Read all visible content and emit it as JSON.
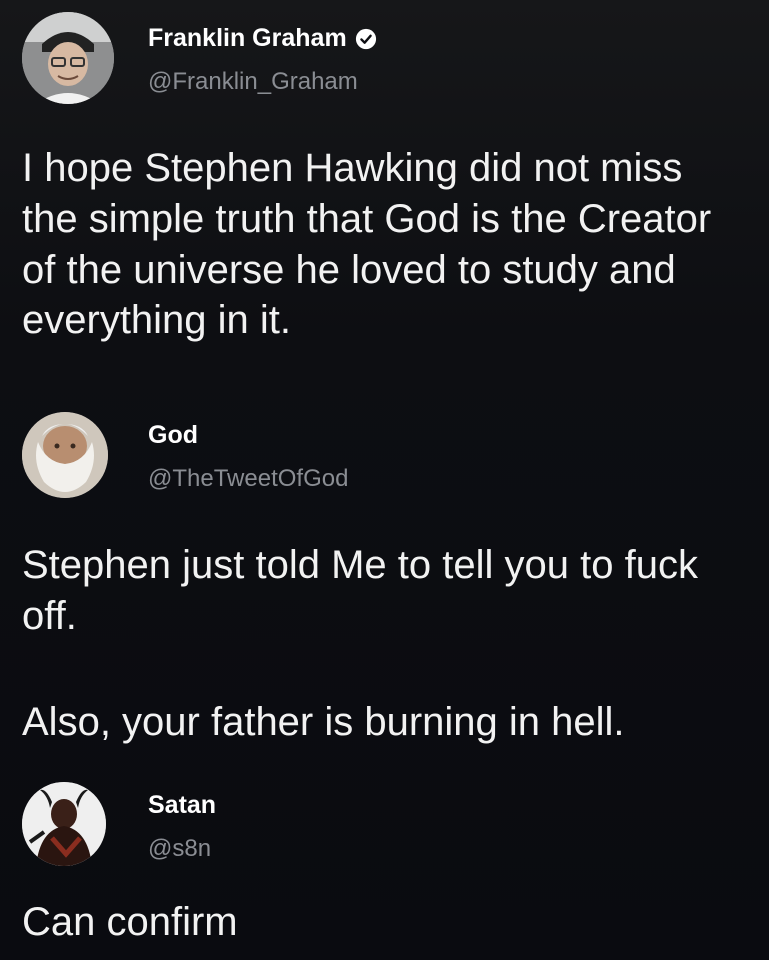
{
  "tweets": [
    {
      "display_name": "Franklin Graham",
      "handle": "@Franklin_Graham",
      "verified": true,
      "text": "I hope Stephen Hawking did not miss the simple truth that God is the Creator of the universe he loved to study and everything in it."
    },
    {
      "display_name": "God",
      "handle": "@TheTweetOfGod",
      "verified": false,
      "text_para1": "Stephen just told Me to tell you to fuck off.",
      "text_para2": "Also, your father is burning in hell."
    },
    {
      "display_name": "Satan",
      "handle": "@s8n",
      "verified": false,
      "text": "Can confirm"
    }
  ],
  "colors": {
    "background": "#0d0e12",
    "text": "#f2f2f2",
    "handle": "#8a8d93"
  },
  "icons": [
    "verified-badge-icon"
  ]
}
